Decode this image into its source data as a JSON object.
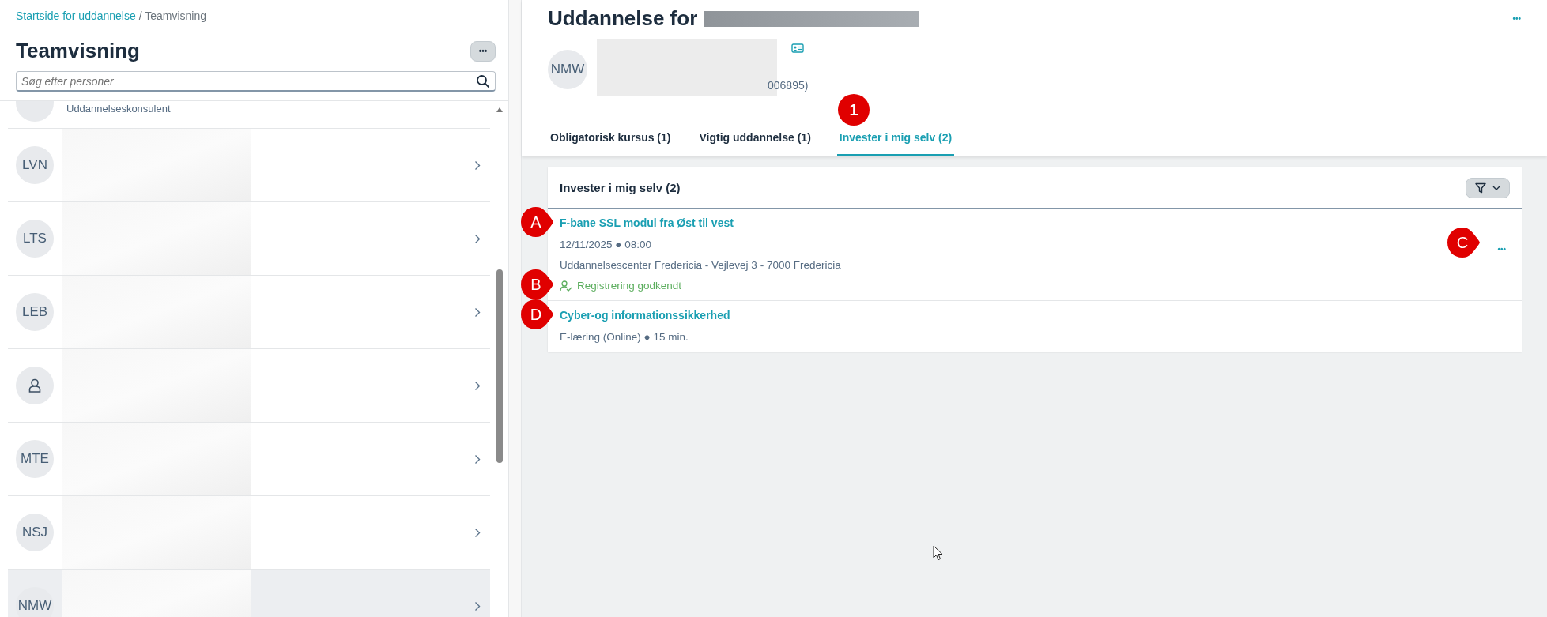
{
  "breadcrumb": {
    "link": "Startside for uddannelse",
    "separator": "/",
    "current": "Teamvisning"
  },
  "sidebar": {
    "title": "Teamvisning",
    "more": "•••",
    "search": {
      "placeholder": "Søg efter personer"
    },
    "people": [
      {
        "kind": "partial",
        "subtitle": "Uddannelseskonsulent",
        "selected": false
      },
      {
        "kind": "initials",
        "initials": "LVN",
        "selected": false
      },
      {
        "kind": "initials",
        "initials": "LTS",
        "selected": false
      },
      {
        "kind": "initials",
        "initials": "LEB",
        "selected": false
      },
      {
        "kind": "icon",
        "selected": false
      },
      {
        "kind": "initials",
        "initials": "MTE",
        "selected": false
      },
      {
        "kind": "initials",
        "initials": "NSJ",
        "selected": false
      },
      {
        "kind": "initials",
        "initials": "NMW",
        "selected": true
      }
    ]
  },
  "main": {
    "title": "Uddannelse for",
    "more": "•••",
    "avatar": "NMW",
    "id_fragment": "006895)",
    "tabs": [
      {
        "label": "Obligatorisk kursus (1)",
        "selected": false
      },
      {
        "label": "Vigtig uddannelse (1)",
        "selected": false
      },
      {
        "label": "Invester i mig selv (2)",
        "selected": true,
        "callout": {
          "label": "1",
          "kind": "circle"
        }
      }
    ],
    "section": {
      "title": "Invester i mig selv (2)",
      "items": [
        {
          "title": "F-bane SSL modul fra Øst til vest",
          "title_callout": {
            "label": "A",
            "kind": "pointer"
          },
          "lines": [
            "12/11/2025 ● 08:00",
            "Uddannelsescenter Fredericia - Vejlevej 3 - 7000 Fredericia"
          ],
          "status": {
            "text": "Registrering godkendt",
            "kind": "approved",
            "callout": {
              "label": "B",
              "kind": "pointer"
            }
          },
          "menu": "•••",
          "menu_callout": {
            "label": "C",
            "kind": "pointer"
          }
        },
        {
          "title": "Cyber-og informationssikkerhed",
          "title_callout": {
            "label": "D",
            "kind": "pointer"
          },
          "lines": [
            "E-læring (Online) ● 15 min."
          ]
        }
      ]
    }
  }
}
